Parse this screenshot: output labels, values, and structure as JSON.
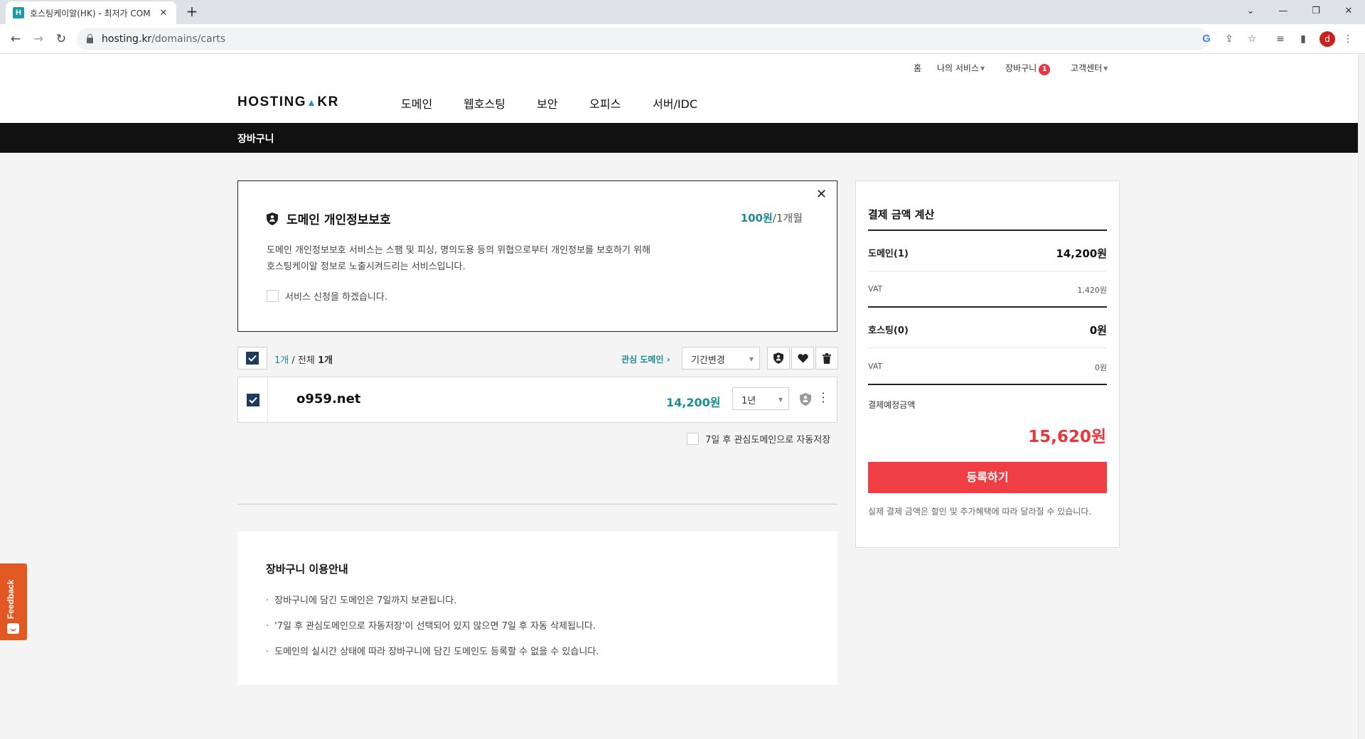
{
  "browser": {
    "tab_title": "호스팅케이알(HK) - 최저가 COM",
    "favicon_letter": "H",
    "new_tab": "+",
    "url_host": "hosting.kr",
    "url_path": "/domains/carts",
    "profile_initial": "d",
    "window_controls": [
      "⌄",
      "—",
      "❐",
      "✕"
    ]
  },
  "header": {
    "util_nav": {
      "home": "홈",
      "my_services": "나의 서비스",
      "cart": "장바구니",
      "cart_count": "1",
      "support": "고객센터"
    },
    "logo": {
      "left": "HOSTING",
      "dot": "▲",
      "right": "KR"
    },
    "main_nav": [
      "도메인",
      "웹호스팅",
      "보안",
      "오피스",
      "서버/IDC"
    ]
  },
  "subbar": {
    "title": "장바구니"
  },
  "privacy": {
    "title": "도메인 개인정보보호",
    "price_amount": "100원",
    "price_unit": "/1개월",
    "desc_line1": "도메인 개인정보보호 서비스는 스팸 및 피싱, 명의도용 등의 위협으로부터 개인정보를 보호하기 위해",
    "desc_line2": "호스팅케이알 정보로 노출시켜드리는 서비스입니다.",
    "checkbox_label": "서비스 신청을 하겠습니다.",
    "close": "✕"
  },
  "cart": {
    "selected": "1개",
    "separator": " / 전체 ",
    "total": "1개",
    "interest_link": "관심 도메인",
    "interest_arrow": "›",
    "period_select": "기간변경",
    "items": [
      {
        "domain": "o959.net",
        "price": "14,200원",
        "period": "1년"
      }
    ],
    "autosave_label": "7일 후 관심도메인으로 자동저장"
  },
  "guide": {
    "title": "장바구니 이용안내",
    "items": [
      "장바구니에 담긴 도메인은 7일까지 보관됩니다.",
      "'7일 후 관심도메인으로 자동저장'이 선택되어 있지 않으면 7일 후 자동 삭제됩니다.",
      "도메인의 실시간 상태에 따라 장바구니에 담긴 도메인도 등록할 수 없을 수 있습니다."
    ]
  },
  "summary": {
    "title": "결제 금액 계산",
    "domain_label": "도메인(1)",
    "domain_amount": "14,200원",
    "domain_vat_label": "VAT",
    "domain_vat": "1,420원",
    "hosting_label": "호스팅(0)",
    "hosting_amount": "0원",
    "hosting_vat_label": "VAT",
    "hosting_vat": "0원",
    "estimate_label": "결제예정금액",
    "estimate_total": "15,620원",
    "register_button": "등록하기",
    "note": "실제 결제 금액은 할인 및 추가혜택에 따라 달라질 수 있습니다."
  },
  "feedback": {
    "label": "Feedback"
  },
  "colors": {
    "accent": "#1e8c93",
    "danger": "#ef3f45",
    "dark": "#111111",
    "check_fill": "#1f3b5c",
    "feedback": "#e25822"
  }
}
